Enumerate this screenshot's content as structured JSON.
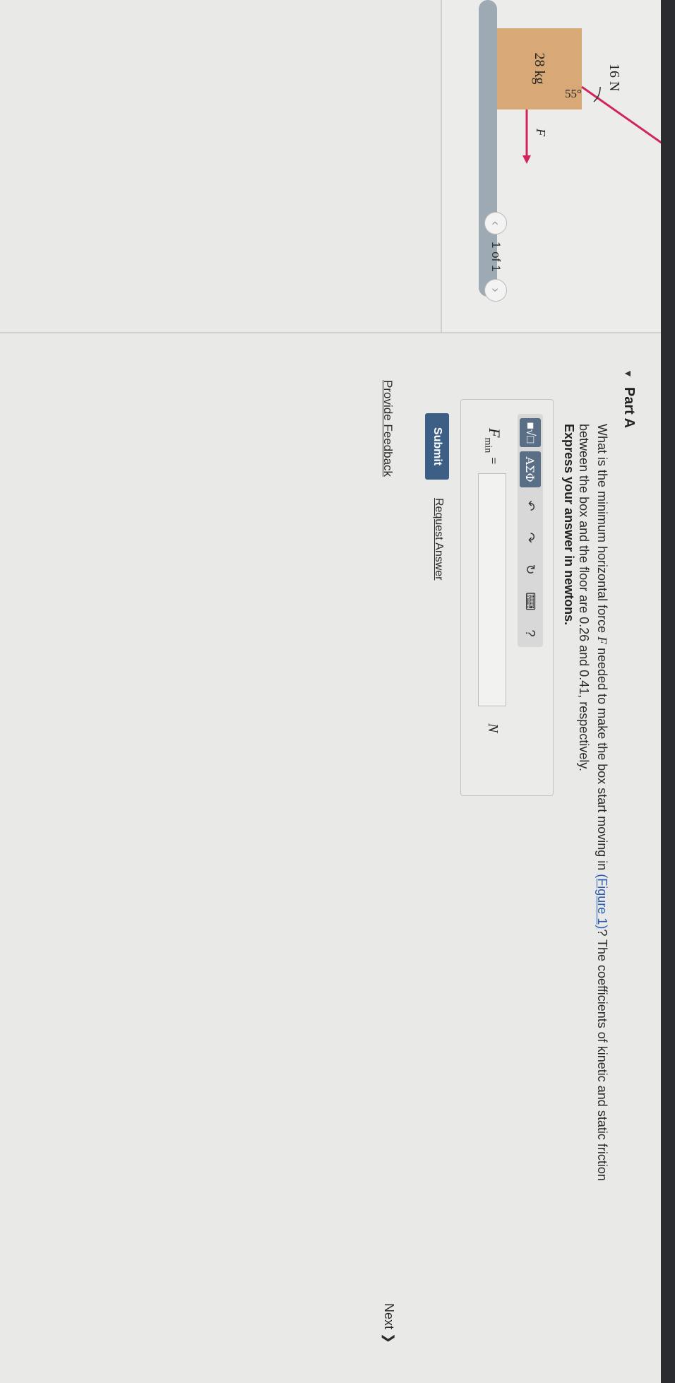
{
  "figure": {
    "mass_label": "28 kg",
    "applied_force_label": "16 N",
    "angle_label": "55°",
    "force_label": "F",
    "colors": {
      "box": "#d8a877",
      "arrow": "#d1245a",
      "floor": "#9da9b3"
    }
  },
  "pager": {
    "prev_icon": "‹",
    "text": "1 of 1",
    "next_icon": "›"
  },
  "part": {
    "caret_icon": "▼",
    "title": "Part A"
  },
  "question": {
    "before_var": "What is the minimum horizontal force ",
    "var": "F",
    "after_var": " needed to make the box start moving in ",
    "figure_link": "(Figure 1)",
    "after_link": "? The coefficients of kinetic and static friction between the box and the floor are 0.26 and 0.41, respectively.",
    "instruction": "Express your answer in newtons."
  },
  "toolbar": {
    "templates_icon": "■√□",
    "symbols_label": "ΑΣΦ",
    "undo_icon": "↶",
    "redo_icon": "↷",
    "reset_icon": "↻",
    "keyboard_icon": "⌨",
    "help_icon": "?"
  },
  "answer": {
    "variable": "F",
    "subscript": "min",
    "equals": "=",
    "value": "",
    "unit": "N"
  },
  "actions": {
    "submit": "Submit",
    "request_answer": "Request Answer",
    "provide_feedback": "Provide Feedback",
    "next": "Next ❯"
  }
}
